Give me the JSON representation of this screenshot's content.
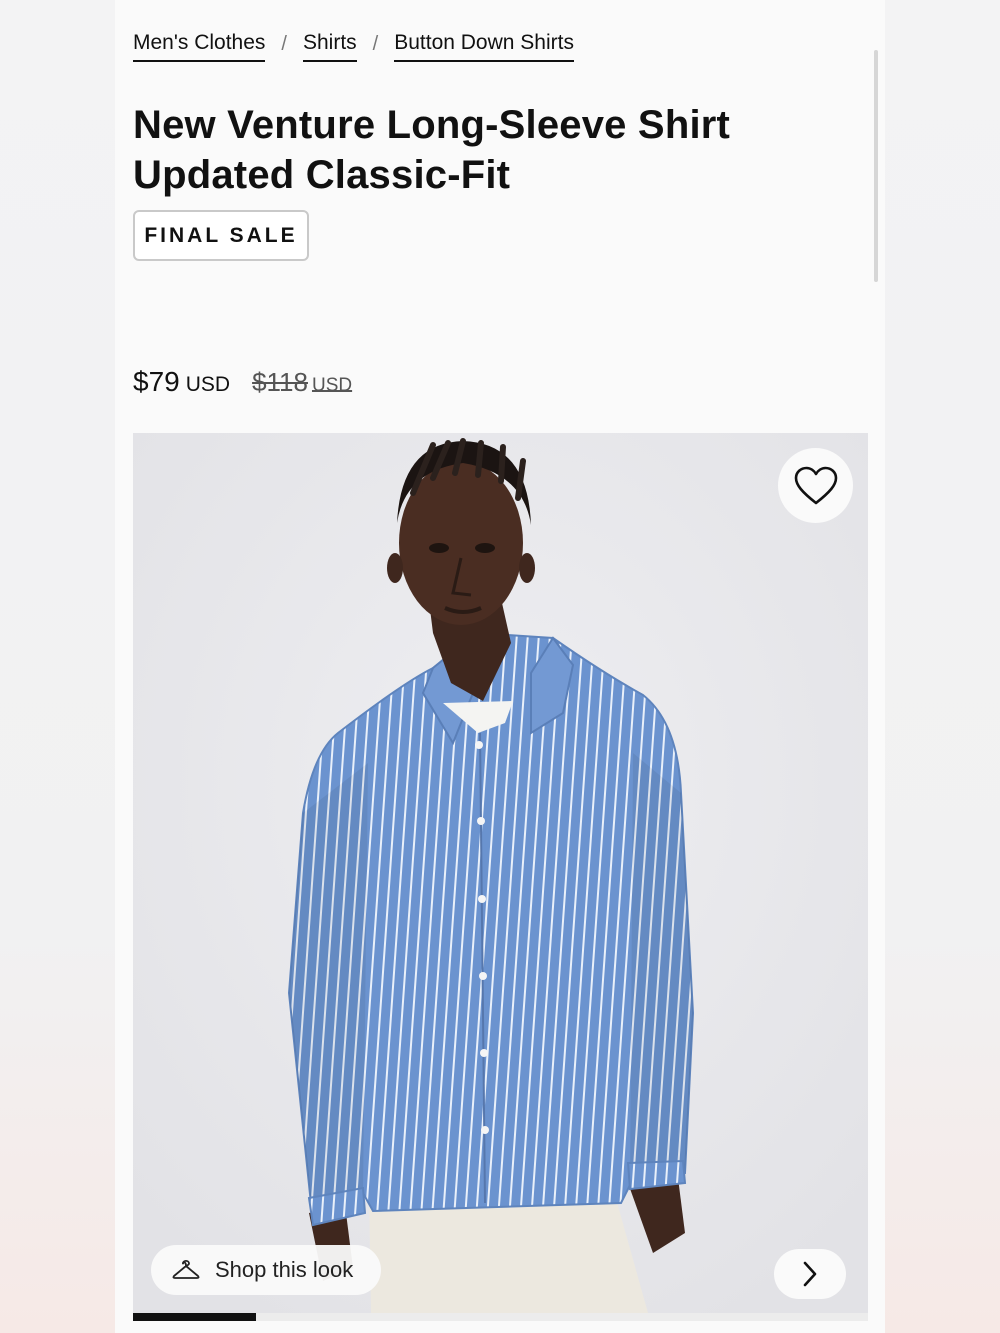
{
  "breadcrumb": [
    {
      "label": "Men's Clothes"
    },
    {
      "label": "Shirts"
    },
    {
      "label": "Button Down Shirts"
    }
  ],
  "breadcrumb_separator": "/",
  "product": {
    "title_line1": "New Venture Long-Sleeve Shirt",
    "title_line2": "Updated Classic-Fit",
    "badge": "FINAL SALE",
    "price": "$79",
    "price_currency": "USD",
    "original_price": "$118",
    "original_currency": "USD"
  },
  "gallery": {
    "wishlist_icon": "heart-outline-icon",
    "shop_this_look_label": "Shop this look",
    "shop_icon": "hanger-icon",
    "next_icon": "chevron-right-icon",
    "image_progress": 0.167
  },
  "colors": {
    "shirt": "#6b93cf",
    "stripe": "#e9f0fa",
    "skin": "#4a2d22",
    "pants": "#ece8df",
    "background": "#e6e6e9"
  }
}
